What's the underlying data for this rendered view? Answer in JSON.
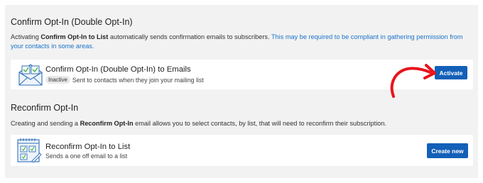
{
  "optin": {
    "title": "Confirm Opt-In (Double Opt-In)",
    "desc_pre": "Activating ",
    "desc_bold": "Confirm Opt-In to List",
    "desc_post": " automatically sends confirmation emails to subscribers. ",
    "desc_link": "This may be required to be compliant in gathering permission from your contacts in some areas.",
    "card": {
      "title": "Confirm Opt-In (Double Opt-In) to Emails",
      "status": "Inactive",
      "subtitle": "Sent to contacts when they join your mailing list",
      "button": "Activate",
      "icon": "envelope-checklist-icon"
    }
  },
  "reconfirm": {
    "title": "Reconfirm Opt-In",
    "desc_pre": "Creating and sending a ",
    "desc_bold": "Reconfirm Opt-In",
    "desc_post": " email allows you to select contacts, by list, that will need to reconfirm their subscription.",
    "card": {
      "title": "Reconfirm Opt-In to List",
      "subtitle": "Sends a one off email to a list",
      "button": "Create new",
      "icon": "calendar-checklist-icon"
    }
  },
  "annotation": {
    "arrow_color": "#e8141c",
    "icon": "red-arrow-icon"
  },
  "colors": {
    "primary": "#1360b8",
    "link": "#1a73c8",
    "panel": "#f2f2f2"
  }
}
